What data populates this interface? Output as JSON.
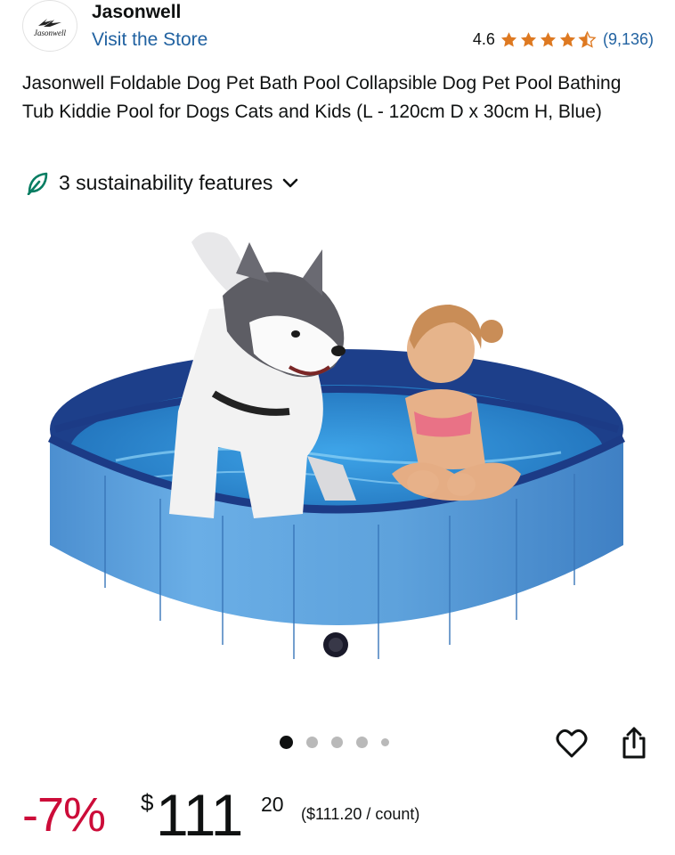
{
  "store": {
    "logo_text": "Jasonwell",
    "brand_name": "Jasonwell",
    "visit_label": "Visit the Store",
    "rating_value": "4.6",
    "rating_stars": 4.6,
    "review_count": "(9,136)"
  },
  "product": {
    "title": "Jasonwell Foldable Dog Pet Bath Pool Collapsible Dog Pet Pool Bathing Tub Kiddie Pool for Dogs Cats and Kids (L - 120cm D x 30cm H, Blue)"
  },
  "sustainability": {
    "label": "3 sustainability features",
    "icon": "leaf-icon"
  },
  "image": {
    "carousel_count": 5,
    "active_index": 0
  },
  "actions": {
    "wishlist_icon": "heart-icon",
    "share_icon": "share-icon"
  },
  "price": {
    "discount": "-7%",
    "currency_symbol": "$",
    "whole": "111",
    "fraction": "20",
    "unit_price": "($111.20 / count)"
  },
  "colors": {
    "link": "#2162a1",
    "star": "#de7921",
    "discount": "#cc0c39",
    "sustainability_leaf": "#067d62"
  }
}
